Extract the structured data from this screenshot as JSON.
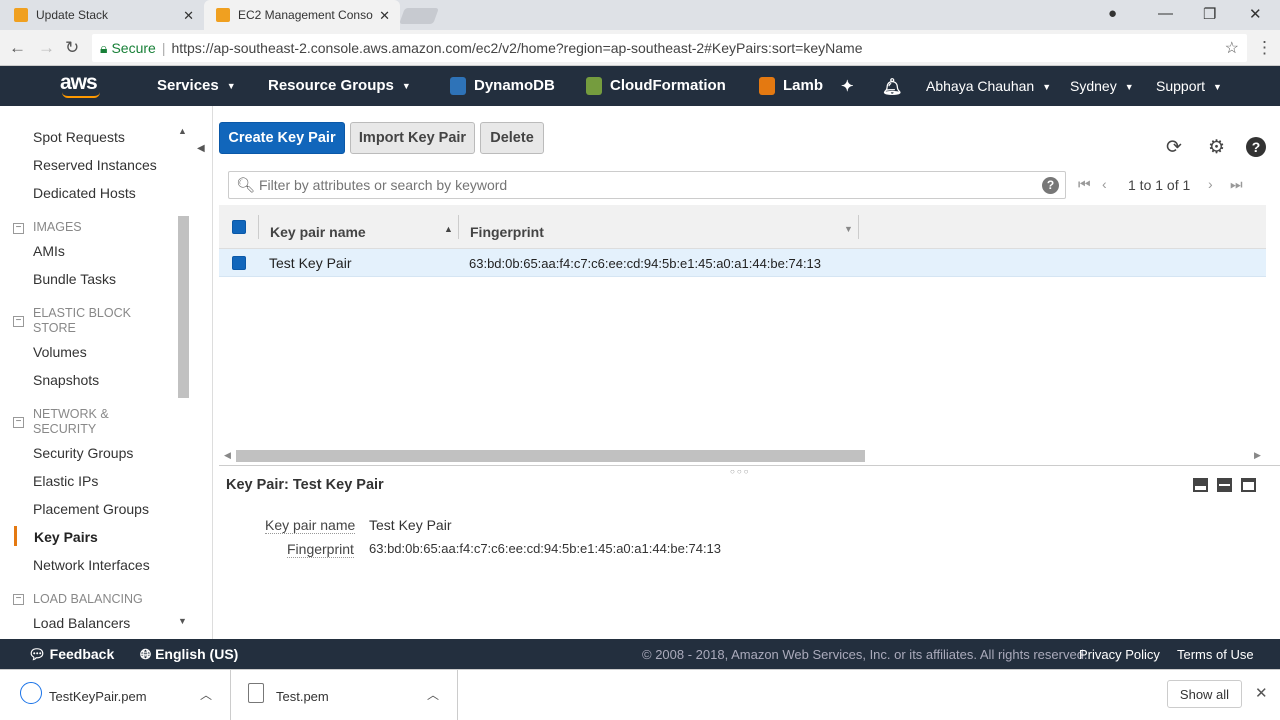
{
  "browser": {
    "tabs": [
      {
        "title": "Update Stack"
      },
      {
        "title": "EC2 Management Conso"
      }
    ],
    "address": {
      "secure_label": "Secure",
      "url": "https://ap-southeast-2.console.aws.amazon.com/ec2/v2/home?region=ap-southeast-2#KeyPairs:sort=keyName"
    }
  },
  "aws_nav": {
    "logo": "aws",
    "services": "Services",
    "resource_groups": "Resource Groups",
    "pinned": [
      {
        "label": "DynamoDB",
        "color": "#2e73b8"
      },
      {
        "label": "CloudFormation",
        "color": "#759c3e"
      },
      {
        "label": "Lamb",
        "color": "#e47911"
      }
    ],
    "user": "Abhaya Chauhan",
    "region": "Sydney",
    "support": "Support"
  },
  "sidebar": {
    "items_top": [
      "Spot Requests",
      "Reserved Instances",
      "Dedicated Hosts"
    ],
    "images": {
      "heading": "IMAGES",
      "items": [
        "AMIs",
        "Bundle Tasks"
      ]
    },
    "ebs": {
      "heading_1": "ELASTIC BLOCK",
      "heading_2": "STORE",
      "items": [
        "Volumes",
        "Snapshots"
      ]
    },
    "network": {
      "heading_1": "NETWORK &",
      "heading_2": "SECURITY",
      "items": [
        "Security Groups",
        "Elastic IPs",
        "Placement Groups",
        "Key Pairs",
        "Network Interfaces"
      ]
    },
    "lb": {
      "heading": "LOAD BALANCING",
      "items": [
        "Load Balancers"
      ]
    },
    "active": "Key Pairs"
  },
  "toolbar": {
    "create": "Create Key Pair",
    "import": "Import Key Pair",
    "delete": "Delete"
  },
  "search": {
    "placeholder": "Filter by attributes or search by keyword",
    "help": "?"
  },
  "pagination": {
    "text": "1 to 1 of 1"
  },
  "table": {
    "columns": [
      "Key pair name",
      "Fingerprint"
    ],
    "rows": [
      {
        "name": "Test Key Pair",
        "fingerprint": "63:bd:0b:65:aa:f4:c7:c6:ee:cd:94:5b:e1:45:a0:a1:44:be:74:13"
      }
    ]
  },
  "detail": {
    "title": "Key Pair: Test Key Pair",
    "fields": [
      {
        "label": "Key pair name",
        "value": "Test Key Pair"
      },
      {
        "label": "Fingerprint",
        "value": "63:bd:0b:65:aa:f4:c7:c6:ee:cd:94:5b:e1:45:a0:a1:44:be:74:13"
      }
    ]
  },
  "footer": {
    "feedback": "Feedback",
    "language": "English (US)",
    "copyright": "© 2008 - 2018, Amazon Web Services, Inc. or its affiliates. All rights reserved.",
    "privacy": "Privacy Policy",
    "terms": "Terms of Use"
  },
  "downloads": {
    "files": [
      "TestKeyPair.pem",
      "Test.pem"
    ],
    "show_all": "Show all"
  },
  "colors": {
    "aws_nav": "#232f3e",
    "primary_button": "#1166bb",
    "active_accent": "#e47911",
    "selected_row": "#e4f1fc"
  }
}
